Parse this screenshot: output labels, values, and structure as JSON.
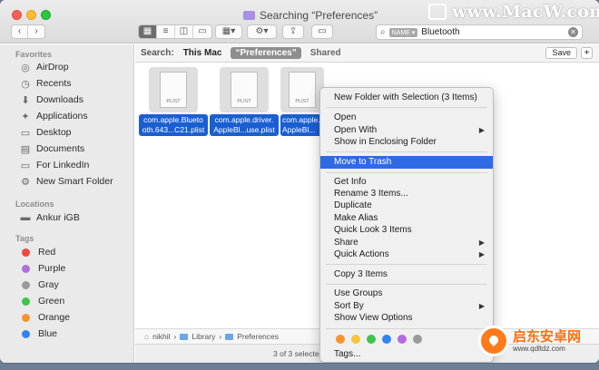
{
  "window": {
    "title": "Searching “Preferences”"
  },
  "toolbar": {
    "back_icon": "chevron-left-icon",
    "forward_icon": "chevron-right-icon",
    "view_icons": [
      "icon-view-icon",
      "list-view-icon",
      "column-view-icon",
      "gallery-view-icon"
    ],
    "group_icon": "group-by-icon",
    "action_icon": "gear-icon",
    "share_icon": "share-icon",
    "tag_icon": "tag-icon"
  },
  "search": {
    "token": "NAME ▾",
    "value": "Bluetooth"
  },
  "scope": {
    "label": "Search:",
    "this_mac": "This Mac",
    "selected": "“Preferences”",
    "shared": "Shared",
    "save": "Save",
    "add": "+"
  },
  "sidebar": {
    "favorites_header": "Favorites",
    "favorites": [
      {
        "label": "AirDrop",
        "icon": "airdrop-icon"
      },
      {
        "label": "Recents",
        "icon": "clock-icon"
      },
      {
        "label": "Downloads",
        "icon": "download-icon"
      },
      {
        "label": "Applications",
        "icon": "applications-icon"
      },
      {
        "label": "Desktop",
        "icon": "desktop-icon"
      },
      {
        "label": "Documents",
        "icon": "document-icon"
      },
      {
        "label": "For LinkedIn",
        "icon": "folder-icon"
      },
      {
        "label": "New Smart Folder",
        "icon": "gear-folder-icon"
      }
    ],
    "locations_header": "Locations",
    "locations": [
      {
        "label": "Ankur iGB",
        "icon": "drive-icon"
      }
    ],
    "tags_header": "Tags",
    "tags": [
      {
        "label": "Red",
        "color": "#f0463c"
      },
      {
        "label": "Purple",
        "color": "#b16ee0"
      },
      {
        "label": "Gray",
        "color": "#9a9a9a"
      },
      {
        "label": "Green",
        "color": "#3ec44c"
      },
      {
        "label": "Orange",
        "color": "#f7932e"
      },
      {
        "label": "Blue",
        "color": "#2f84f2"
      }
    ]
  },
  "files": [
    {
      "type": "PLIST",
      "name1": "com.apple.Blueto",
      "name2": "oth.643...C21.plist"
    },
    {
      "type": "PLIST",
      "name1": "com.apple.driver.",
      "name2": "AppleBl...use.plist"
    },
    {
      "type": "PLIST",
      "name1": "com.apple.",
      "name2": "AppleBl..."
    }
  ],
  "pathbar": [
    "nikhil",
    "Library",
    "Preferences"
  ],
  "status": "3 of 3 selecte",
  "menu": {
    "items": [
      {
        "label": "New Folder with Selection (3 Items)"
      },
      {
        "label": "Open"
      },
      {
        "label": "Open With",
        "submenu": "▶"
      },
      {
        "label": "Show in Enclosing Folder"
      },
      {
        "label": "Move to Trash"
      },
      {
        "label": "Get Info"
      },
      {
        "label": "Rename 3 Items..."
      },
      {
        "label": "Duplicate"
      },
      {
        "label": "Make Alias"
      },
      {
        "label": "Quick Look 3 Items"
      },
      {
        "label": "Share",
        "submenu": "▶"
      },
      {
        "label": "Quick Actions",
        "submenu": "▶"
      },
      {
        "label": "Copy 3 Items"
      },
      {
        "label": "Use Groups"
      },
      {
        "label": "Sort By",
        "submenu": "▶"
      },
      {
        "label": "Show View Options"
      },
      {
        "label": "Tags..."
      }
    ],
    "highlighted": "Move to Trash",
    "tag_colors": [
      "#f7932e",
      "#f6c53a",
      "#3ec44c",
      "#2f84f2",
      "#b16ee0",
      "#9a9a9a"
    ]
  },
  "watermark": {
    "text": "www.MacW.com"
  },
  "logo": {
    "cn": "启东安卓网",
    "url": "www.qdltdz.com"
  }
}
